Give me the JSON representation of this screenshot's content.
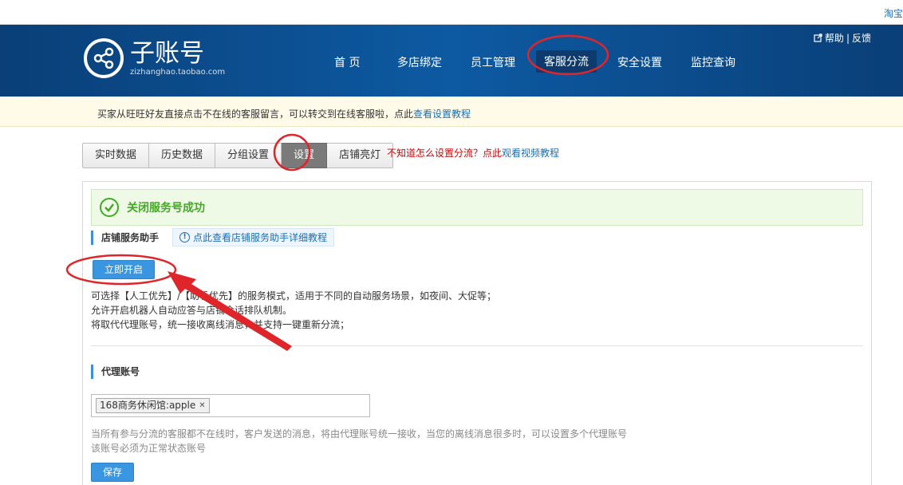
{
  "topbar": {
    "right_link": "淘宝"
  },
  "logo": {
    "title": "子账号",
    "subtitle": "zizhanghao.taobao.com"
  },
  "nav": {
    "items": [
      "首 页",
      "多店绑定",
      "员工管理",
      "客服分流",
      "安全设置",
      "监控查询"
    ],
    "active_index": 3,
    "help": "帮助",
    "feedback": "反馈",
    "separator": "|"
  },
  "notice": {
    "text": "买家从旺旺好友直接点击不在线的客服留言，可以转交到在线客服啦，点此",
    "link": "查看设置教程"
  },
  "tabs": {
    "items": [
      "实时数据",
      "历史数据",
      "分组设置",
      "设置",
      "店铺亮灯"
    ],
    "active_index": 3
  },
  "tab_hint": {
    "text": "不知道怎么设置分流？点此",
    "link": "观看视频教程"
  },
  "success_message": "关闭服务号成功",
  "store_assistant": {
    "title": "店铺服务助手",
    "help_link": "点此查看店铺服务助手详细教程",
    "enable_button": "立即开启",
    "desc_lines": [
      "可选择【人工优先】/【助手优先】的服务模式，适用于不同的自动服务场景，如夜间、大促等；",
      "允许开启机器人自动应答与店铺会话排队机制。",
      "将取代代理账号，统一接收离线消息，并支持一键重新分流；"
    ]
  },
  "agent_account": {
    "title": "代理账号",
    "tag": "168商务休闲馆:apple",
    "tag_remove": "✕",
    "note_lines": [
      "当所有参与分流的客服都不在线时，客户发送的消息，将由代理账号统一接收，当您的离线消息很多时，可以设置多个代理账号",
      "该账号必须为正常状态账号"
    ],
    "save_button": "保存"
  },
  "annotation_color": "#e0252a",
  "colors": {
    "header": "#0d5aa2",
    "primary_button": "#3a96e0",
    "success": "#44a827",
    "link": "#1a6fb7",
    "warning": "#d40000"
  }
}
